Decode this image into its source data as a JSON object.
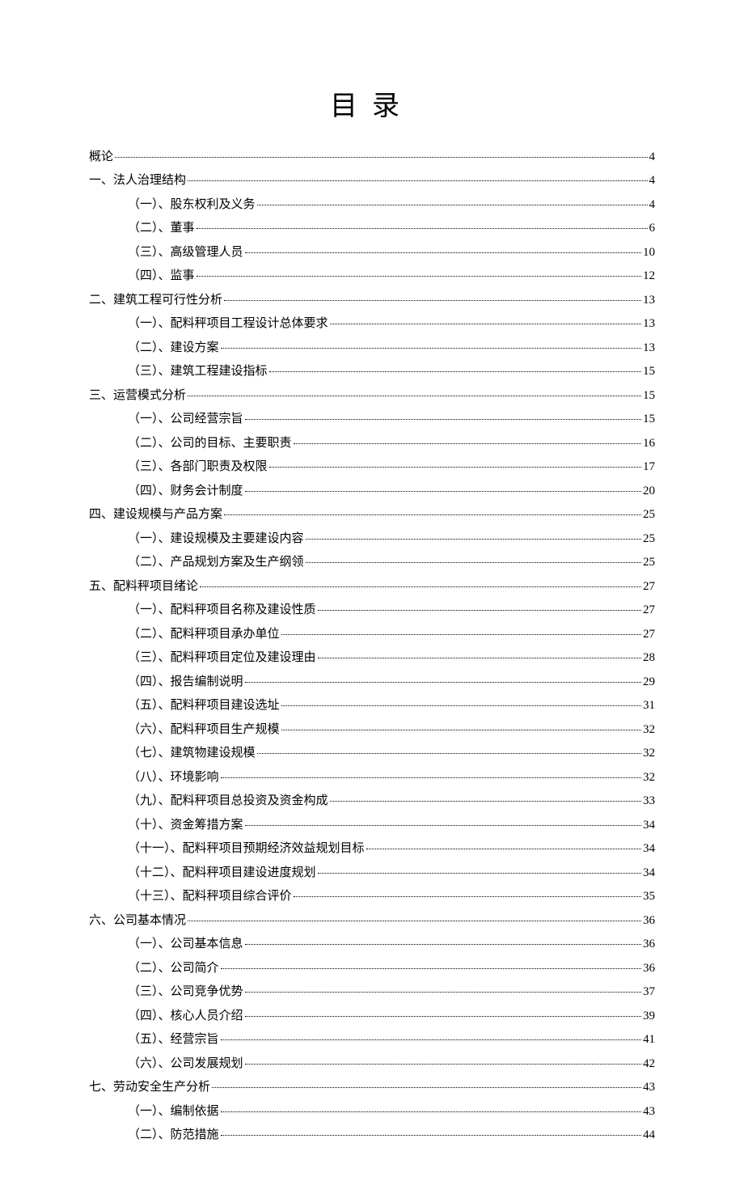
{
  "title": "目录",
  "toc": [
    {
      "level": 0,
      "text": "概论",
      "page": "4"
    },
    {
      "level": 1,
      "text": "一、法人治理结构",
      "page": "4"
    },
    {
      "level": 2,
      "text": "（一）、股东权利及义务",
      "page": "4"
    },
    {
      "level": 2,
      "text": "（二）、董事",
      "page": "6"
    },
    {
      "level": 2,
      "text": "（三）、高级管理人员",
      "page": "10"
    },
    {
      "level": 2,
      "text": "（四）、监事",
      "page": "12"
    },
    {
      "level": 1,
      "text": "二、建筑工程可行性分析",
      "page": "13"
    },
    {
      "level": 2,
      "text": "（一）、配料秤项目工程设计总体要求",
      "page": "13"
    },
    {
      "level": 2,
      "text": "（二）、建设方案",
      "page": "13"
    },
    {
      "level": 2,
      "text": "（三）、建筑工程建设指标",
      "page": "15"
    },
    {
      "level": 1,
      "text": "三、运营模式分析",
      "page": "15"
    },
    {
      "level": 2,
      "text": "（一）、公司经营宗旨",
      "page": "15"
    },
    {
      "level": 2,
      "text": "（二）、公司的目标、主要职责",
      "page": "16"
    },
    {
      "level": 2,
      "text": "（三）、各部门职责及权限",
      "page": "17"
    },
    {
      "level": 2,
      "text": "（四）、财务会计制度",
      "page": "20"
    },
    {
      "level": 1,
      "text": "四、建设规模与产品方案",
      "page": "25"
    },
    {
      "level": 2,
      "text": "（一）、建设规模及主要建设内容",
      "page": "25"
    },
    {
      "level": 2,
      "text": "（二）、产品规划方案及生产纲领",
      "page": "25"
    },
    {
      "level": 1,
      "text": "五、配料秤项目绪论",
      "page": "27"
    },
    {
      "level": 2,
      "text": "（一）、配料秤项目名称及建设性质",
      "page": "27"
    },
    {
      "level": 2,
      "text": "（二）、配料秤项目承办单位",
      "page": "27"
    },
    {
      "level": 2,
      "text": "（三）、配料秤项目定位及建设理由",
      "page": "28"
    },
    {
      "level": 2,
      "text": "（四）、报告编制说明",
      "page": "29"
    },
    {
      "level": 2,
      "text": "（五）、配料秤项目建设选址",
      "page": "31"
    },
    {
      "level": 2,
      "text": "（六）、配料秤项目生产规模",
      "page": "32"
    },
    {
      "level": 2,
      "text": "（七）、建筑物建设规模",
      "page": "32"
    },
    {
      "level": 2,
      "text": "（八）、环境影响",
      "page": "32"
    },
    {
      "level": 2,
      "text": "（九）、配料秤项目总投资及资金构成",
      "page": "33"
    },
    {
      "level": 2,
      "text": "（十）、资金筹措方案",
      "page": "34"
    },
    {
      "level": 2,
      "text": "（十一）、配料秤项目预期经济效益规划目标",
      "page": "34"
    },
    {
      "level": 2,
      "text": "（十二）、配料秤项目建设进度规划",
      "page": "34"
    },
    {
      "level": 2,
      "text": "（十三）、配料秤项目综合评价",
      "page": "35"
    },
    {
      "level": 1,
      "text": "六、公司基本情况",
      "page": "36"
    },
    {
      "level": 2,
      "text": "（一）、公司基本信息",
      "page": "36"
    },
    {
      "level": 2,
      "text": "（二）、公司简介",
      "page": "36"
    },
    {
      "level": 2,
      "text": "（三）、公司竞争优势",
      "page": "37"
    },
    {
      "level": 2,
      "text": "（四）、核心人员介绍",
      "page": "39"
    },
    {
      "level": 2,
      "text": "（五）、经营宗旨",
      "page": "41"
    },
    {
      "level": 2,
      "text": "（六）、公司发展规划",
      "page": "42"
    },
    {
      "level": 1,
      "text": "七、劳动安全生产分析",
      "page": "43"
    },
    {
      "level": 2,
      "text": "（一）、编制依据",
      "page": "43"
    },
    {
      "level": 2,
      "text": "（二）、防范措施",
      "page": "44"
    }
  ]
}
